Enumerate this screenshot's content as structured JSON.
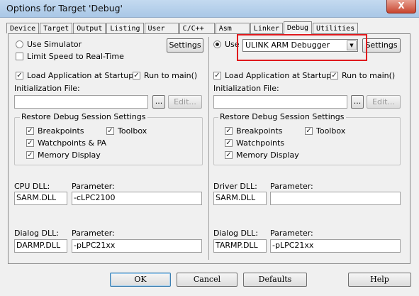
{
  "window": {
    "title": "Options for Target 'Debug'",
    "close_glyph": "X"
  },
  "tabs": [
    {
      "label": "Device",
      "active": false
    },
    {
      "label": "Target",
      "active": false
    },
    {
      "label": "Output",
      "active": false
    },
    {
      "label": "Listing",
      "active": false
    },
    {
      "label": "User",
      "active": false
    },
    {
      "label": "C/C++",
      "active": false
    },
    {
      "label": "Asm",
      "active": false
    },
    {
      "label": "Linker",
      "active": false
    },
    {
      "label": "Debug",
      "active": true
    },
    {
      "label": "Utilities",
      "active": false
    }
  ],
  "left": {
    "use_simulator_label": "Use Simulator",
    "limit_speed_label": "Limit Speed to Real-Time",
    "settings_label": "Settings",
    "load_app_label": "Load Application at Startup",
    "run_to_main_label": "Run to main()",
    "init_file_label": "Initialization File:",
    "init_file_value": "",
    "browse_label": "...",
    "edit_label": "Edit...",
    "restore_group_label": "Restore Debug Session Settings",
    "breakpoints_label": "Breakpoints",
    "toolbox_label": "Toolbox",
    "watchpoints_label": "Watchpoints & PA",
    "memory_display_label": "Memory Display",
    "cpu_dll_label": "CPU DLL:",
    "cpu_dll_value": "SARM.DLL",
    "cpu_param_label": "Parameter:",
    "cpu_param_value": "-cLPC2100",
    "dialog_dll_label": "Dialog DLL:",
    "dialog_dll_value": "DARMP.DLL",
    "dialog_param_label": "Parameter:",
    "dialog_param_value": "-pLPC21xx"
  },
  "right": {
    "use_label": "Use",
    "debugger_value": "ULINK ARM Debugger",
    "settings_label": "Settings",
    "load_app_label": "Load Application at Startup",
    "run_to_main_label": "Run to main()",
    "init_file_label": "Initialization File:",
    "init_file_value": "",
    "browse_label": "...",
    "edit_label": "Edit...",
    "restore_group_label": "Restore Debug Session Settings",
    "breakpoints_label": "Breakpoints",
    "toolbox_label": "Toolbox",
    "watchpoints_label": "Watchpoints",
    "memory_display_label": "Memory Display",
    "driver_dll_label": "Driver DLL:",
    "driver_dll_value": "SARM.DLL",
    "driver_param_label": "Parameter:",
    "driver_param_value": "",
    "dialog_dll_label": "Dialog DLL:",
    "dialog_dll_value": "TARMP.DLL",
    "dialog_param_label": "Parameter:",
    "dialog_param_value": "-pLPC21xx"
  },
  "footer": {
    "ok_label": "OK",
    "cancel_label": "Cancel",
    "defaults_label": "Defaults",
    "help_label": "Help"
  },
  "colors": {
    "highlight_box": "#e0191d",
    "close_button": "#c8452f",
    "title_bar": "#b6d0ea"
  }
}
